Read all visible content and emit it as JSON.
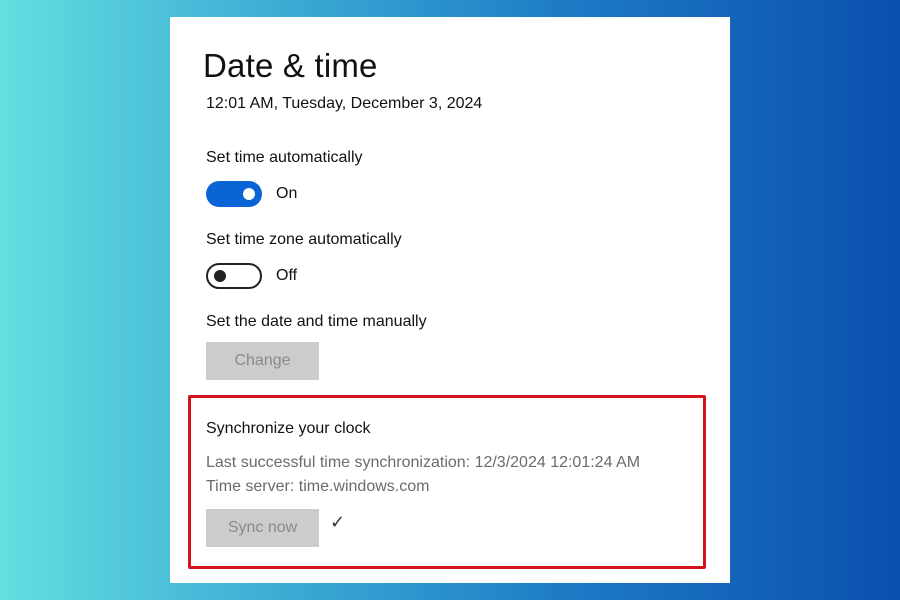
{
  "page": {
    "title": "Date & time",
    "current_datetime": "12:01 AM, Tuesday, December 3, 2024"
  },
  "set_time_auto": {
    "label": "Set time automatically",
    "state": "On",
    "checked": true
  },
  "set_timezone_auto": {
    "label": "Set time zone automatically",
    "state": "Off",
    "checked": false
  },
  "manual": {
    "label": "Set the date and time manually",
    "button_label": "Change"
  },
  "sync": {
    "title": "Synchronize your clock",
    "last_sync": "Last successful time synchronization: 12/3/2024 12:01:24 AM",
    "server": "Time server: time.windows.com",
    "button_label": "Sync now",
    "check_mark": "✓"
  },
  "colors": {
    "accent": "#0a64d6",
    "highlight_border": "#d4141c",
    "disabled_button": "#cccccc"
  }
}
